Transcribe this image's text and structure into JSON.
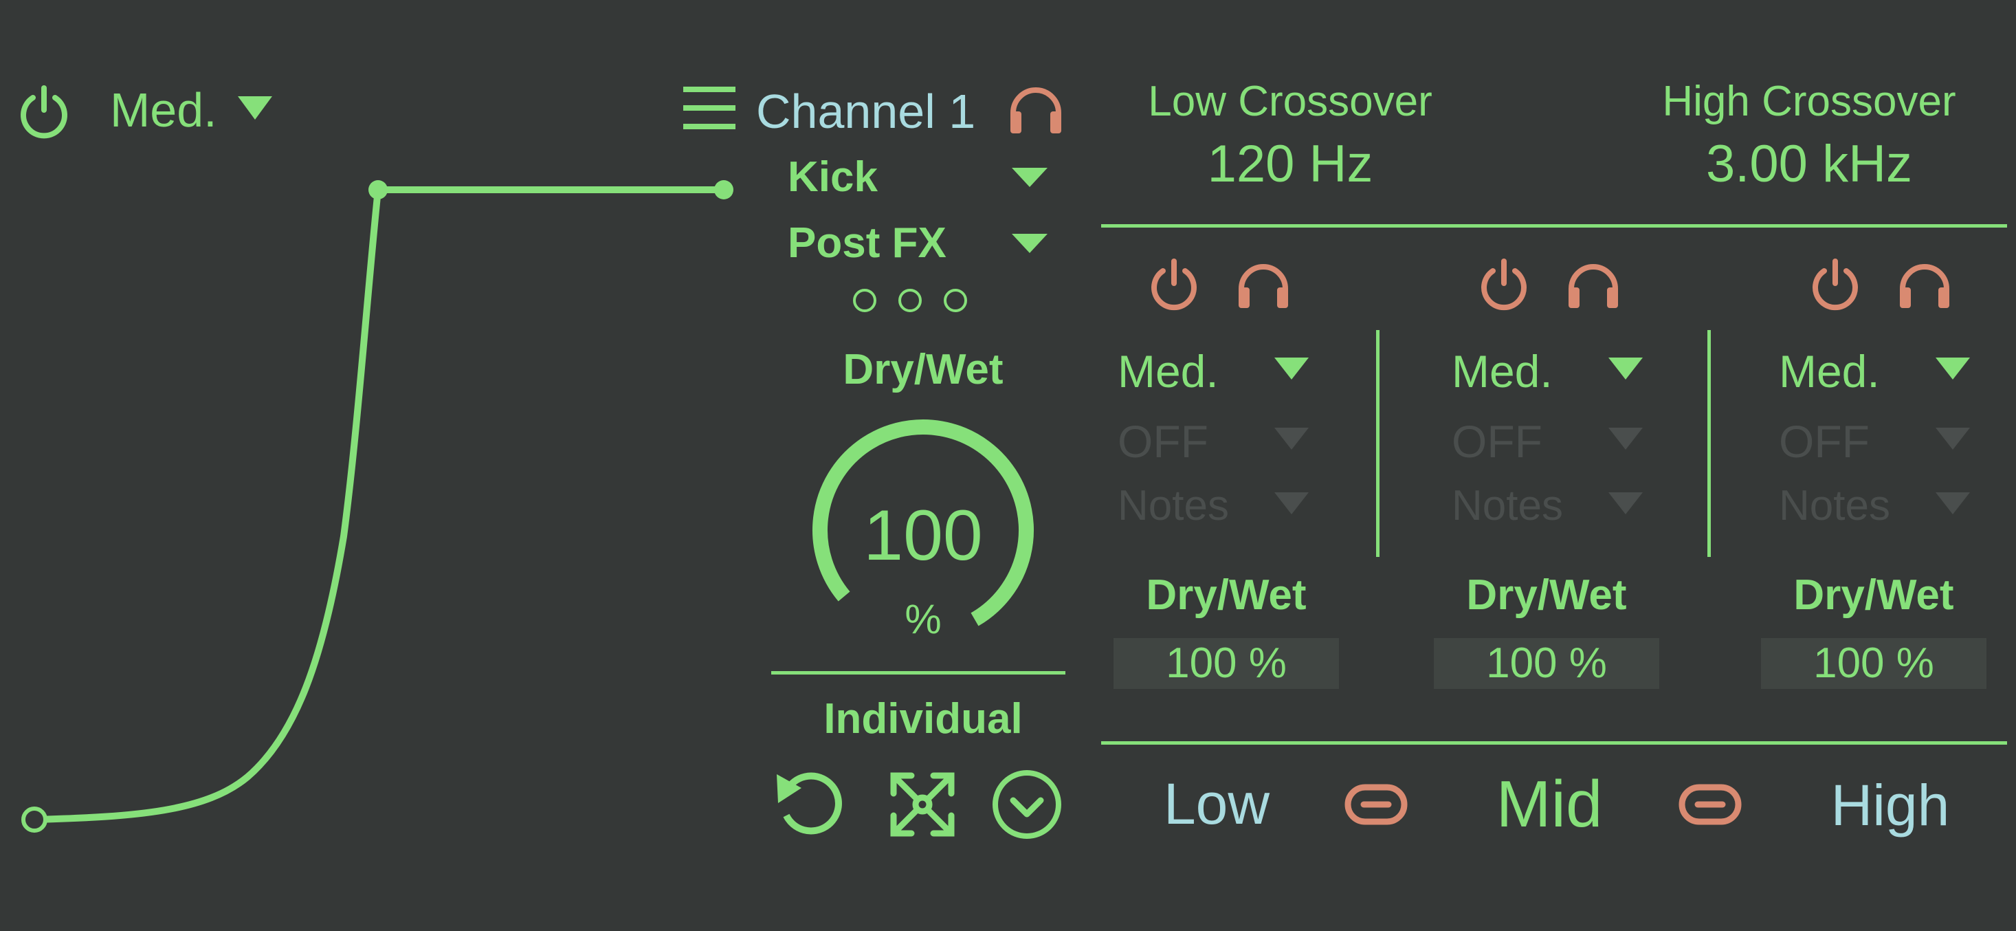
{
  "device": {
    "on": true,
    "preset_mode": "Med.",
    "curve_points": [
      {
        "label": "start"
      },
      {
        "label": "knee"
      },
      {
        "label": "end"
      }
    ]
  },
  "channel": {
    "title": "Channel 1",
    "source": "Kick",
    "tap": "Post FX",
    "drywet_label": "Dry/Wet",
    "drywet_value": "100",
    "drywet_unit": "%",
    "drywet_fraction": 1.0,
    "mode_label": "Individual"
  },
  "crossover": {
    "low_label": "Low Crossover",
    "low_value": "120 Hz",
    "high_label": "High Crossover",
    "high_value": "3.00 kHz"
  },
  "bands": [
    {
      "name": "Low",
      "mode": "Med.",
      "off_label": "OFF",
      "notes_label": "Notes",
      "drywet_label": "Dry/Wet",
      "drywet_value": "100 %"
    },
    {
      "name": "Mid",
      "mode": "Med.",
      "off_label": "OFF",
      "notes_label": "Notes",
      "drywet_label": "Dry/Wet",
      "drywet_value": "100 %"
    },
    {
      "name": "High",
      "mode": "Med.",
      "off_label": "OFF",
      "notes_label": "Notes",
      "drywet_label": "Dry/Wet",
      "drywet_value": "100 %"
    }
  ],
  "colors": {
    "background": "#353837",
    "accent_green": "#86e07a",
    "salmon": "#d98a71",
    "pale_blue": "#a9dbe0",
    "dimmed": "#4a4e4d",
    "value_box": "#404542"
  },
  "icons": {
    "power": "power-icon",
    "menu": "hamburger-menu-icon",
    "headphones": "headphones-icon",
    "dropdown": "triangle-down-icon",
    "reset": "reset-icon",
    "expand": "expand-icon",
    "check": "check-circle-icon",
    "link": "link-icon"
  }
}
